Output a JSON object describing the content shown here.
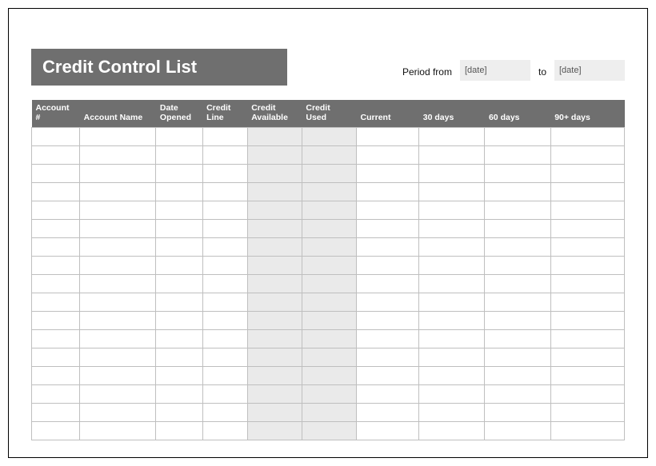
{
  "title": "Credit Control List",
  "period": {
    "label_from": "Period from",
    "date_from": "[date]",
    "label_to": "to",
    "date_to": "[date]"
  },
  "columns": [
    "Account #",
    "Account Name",
    "Date Opened",
    "Credit Line",
    "Credit Available",
    "Credit Used",
    "Current",
    "30 days",
    "60 days",
    "90+ days"
  ],
  "shaded_column_indices": [
    4,
    5
  ],
  "row_count": 17
}
